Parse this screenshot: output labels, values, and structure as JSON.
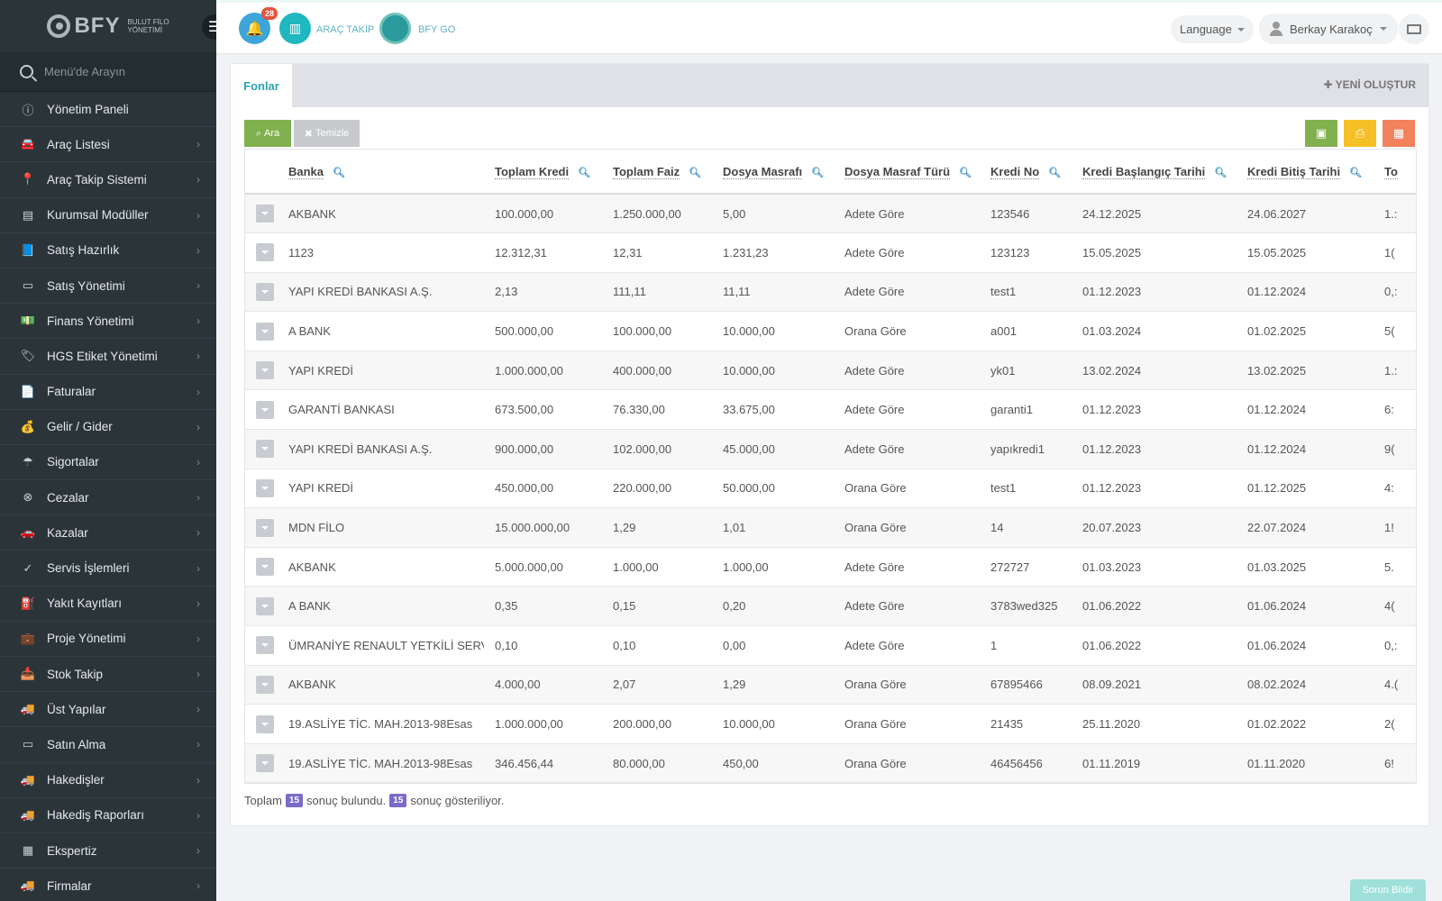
{
  "app": {
    "logo_text": "BFY",
    "logo_sub_line1": "BULUT FİLO",
    "logo_sub_line2": "YÖNETİMİ"
  },
  "sidebar": {
    "search_placeholder": "Menü'de Arayın",
    "items": [
      {
        "label": "Yönetim Paneli",
        "icon": "dashboard-icon",
        "glyph": "ⓘ",
        "chevron": false
      },
      {
        "label": "Araç Listesi",
        "icon": "car-icon",
        "glyph": "🚘",
        "chevron": true
      },
      {
        "label": "Araç Takip Sistemi",
        "icon": "map-marker-icon",
        "glyph": "📍",
        "chevron": true
      },
      {
        "label": "Kurumsal Modüller",
        "icon": "server-icon",
        "glyph": "▤",
        "chevron": true
      },
      {
        "label": "Satış Hazırlık",
        "icon": "book-icon",
        "glyph": "📘",
        "chevron": true
      },
      {
        "label": "Satış Yönetimi",
        "icon": "credit-card-icon",
        "glyph": "▭",
        "chevron": true
      },
      {
        "label": "Finans Yönetimi",
        "icon": "money-icon",
        "glyph": "💵",
        "chevron": true
      },
      {
        "label": "HGS Etiket Yönetimi",
        "icon": "tag-icon",
        "glyph": "🏷",
        "chevron": true
      },
      {
        "label": "Faturalar",
        "icon": "file-icon",
        "glyph": "📄",
        "chevron": true
      },
      {
        "label": "Gelir / Gider",
        "icon": "cash-icon",
        "glyph": "💰",
        "chevron": true
      },
      {
        "label": "Sigortalar",
        "icon": "umbrella-icon",
        "glyph": "☂",
        "chevron": true
      },
      {
        "label": "Cezalar",
        "icon": "times-circle-icon",
        "glyph": "⊗",
        "chevron": true
      },
      {
        "label": "Kazalar",
        "icon": "car-crash-icon",
        "glyph": "🚗",
        "chevron": true
      },
      {
        "label": "Servis İşlemleri",
        "icon": "check-circle-icon",
        "glyph": "✓",
        "chevron": true
      },
      {
        "label": "Yakıt Kayıtları",
        "icon": "gas-pump-icon",
        "glyph": "⛽",
        "chevron": true
      },
      {
        "label": "Proje Yönetimi",
        "icon": "briefcase-icon",
        "glyph": "💼",
        "chevron": true
      },
      {
        "label": "Stok Takip",
        "icon": "inbox-icon",
        "glyph": "📥",
        "chevron": true
      },
      {
        "label": "Üst Yapılar",
        "icon": "truck-icon",
        "glyph": "🚚",
        "chevron": true
      },
      {
        "label": "Satın Alma",
        "icon": "credit-card-icon",
        "glyph": "▭",
        "chevron": true
      },
      {
        "label": "Hakedişler",
        "icon": "truck-icon",
        "glyph": "🚚",
        "chevron": true
      },
      {
        "label": "Hakediş Raporları",
        "icon": "truck-icon",
        "glyph": "🚚",
        "chevron": true
      },
      {
        "label": "Ekspertiz",
        "icon": "list-alt-icon",
        "glyph": "▦",
        "chevron": true
      },
      {
        "label": "Firmalar",
        "icon": "truck-icon",
        "glyph": "🚚",
        "chevron": true
      }
    ]
  },
  "topbar": {
    "notification_count": "28",
    "arac_takip_label": "ARAÇ TAKİP",
    "bfy_go_label": "BFY GO",
    "language_label": "Language",
    "user_name": "Berkay Karakoç"
  },
  "panel": {
    "tab_label": "Fonlar",
    "new_button": "YENİ OLUŞTUR",
    "search_button": "Ara",
    "clear_button": "Temizle"
  },
  "table": {
    "columns": [
      "Banka",
      "Toplam Kredi",
      "Toplam Faiz",
      "Dosya Masrafı",
      "Dosya Masraf Türü",
      "Kredi No",
      "Kredi Başlangıç Tarihi",
      "Kredi Bitiş Tarihi",
      "To"
    ],
    "rows": [
      [
        "AKBANK",
        "100.000,00",
        "1.250.000,00",
        "5,00",
        "Adete Göre",
        "123546",
        "24.12.2025",
        "24.06.2027",
        "1.:"
      ],
      [
        "1123",
        "12.312,31",
        "12,31",
        "1.231,23",
        "Adete Göre",
        "123123",
        "15.05.2025",
        "15.05.2025",
        "1("
      ],
      [
        "YAPI KREDİ BANKASI A.Ş.",
        "2,13",
        "111,11",
        "11,11",
        "Adete Göre",
        "test1",
        "01.12.2023",
        "01.12.2024",
        "0,:"
      ],
      [
        "A BANK",
        "500.000,00",
        "100.000,00",
        "10.000,00",
        "Orana Göre",
        "a001",
        "01.03.2024",
        "01.02.2025",
        "5("
      ],
      [
        "YAPI KREDİ",
        "1.000.000,00",
        "400.000,00",
        "10.000,00",
        "Adete Göre",
        "yk01",
        "13.02.2024",
        "13.02.2025",
        "1.:"
      ],
      [
        "GARANTİ BANKASI",
        "673.500,00",
        "76.330,00",
        "33.675,00",
        "Adete Göre",
        "garanti1",
        "01.12.2023",
        "01.12.2024",
        "6:"
      ],
      [
        "YAPI KREDİ BANKASI A.Ş.",
        "900.000,00",
        "102.000,00",
        "45.000,00",
        "Adete Göre",
        "yapıkredi1",
        "01.12.2023",
        "01.12.2024",
        "9("
      ],
      [
        "YAPI KREDİ",
        "450.000,00",
        "220.000,00",
        "50.000,00",
        "Orana Göre",
        "test1",
        "01.12.2023",
        "01.12.2025",
        "4:"
      ],
      [
        "MDN FİLO",
        "15.000.000,00",
        "1,29",
        "1,01",
        "Orana Göre",
        "14",
        "20.07.2023",
        "22.07.2024",
        "1!"
      ],
      [
        "AKBANK",
        "5.000.000,00",
        "1.000,00",
        "1.000,00",
        "Adete Göre",
        "272727",
        "01.03.2023",
        "01.03.2025",
        "5."
      ],
      [
        "A BANK",
        "0,35",
        "0,15",
        "0,20",
        "Adete Göre",
        "3783wed325",
        "01.06.2022",
        "01.06.2024",
        "4("
      ],
      [
        "ÜMRANİYE RENAULT YETKİLİ SERVİS",
        "0,10",
        "0,10",
        "0,00",
        "Adete Göre",
        "1",
        "01.06.2022",
        "01.06.2024",
        "0,:"
      ],
      [
        "AKBANK",
        "4.000,00",
        "2,07",
        "1,29",
        "Orana Göre",
        "67895466",
        "08.09.2021",
        "08.02.2024",
        "4.("
      ],
      [
        "19.ASLİYE TİC. MAH.2013-98Esas",
        "1.000.000,00",
        "200.000,00",
        "10.000,00",
        "Orana Göre",
        "21435",
        "25.11.2020",
        "01.02.2022",
        "2("
      ],
      [
        "19.ASLİYE TİC. MAH.2013-98Esas",
        "346.456,44",
        "80.000,00",
        "450,00",
        "Orana Göre",
        "46456456",
        "01.11.2019",
        "01.11.2020",
        "6!"
      ]
    ]
  },
  "summary": {
    "prefix": "Toplam",
    "found_count": "15",
    "found_text": "sonuç bulundu.",
    "shown_count": "15",
    "shown_text": "sonuç gösteriliyor."
  },
  "report_button": "Sorun Bildir",
  "colors": {
    "sidebar_bg": "#2b3539",
    "accent": "#2aa3b5",
    "search_btn": "#81b04f",
    "print_btn": "#f5c026",
    "columns_btn": "#f1825c",
    "badge": "#7a6bc8"
  }
}
